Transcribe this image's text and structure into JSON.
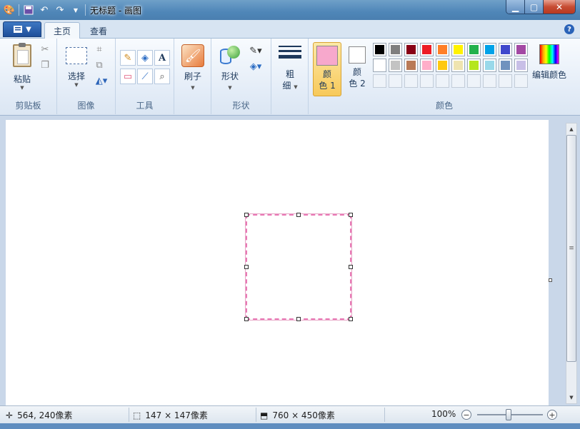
{
  "window": {
    "title": "无标题 - 画图"
  },
  "tabs": [
    {
      "label": "主页",
      "active": true
    },
    {
      "label": "查看",
      "active": false
    }
  ],
  "ribbon": {
    "clipboard": {
      "paste_label": "粘贴",
      "group_label": "剪贴板"
    },
    "image": {
      "select_label": "选择",
      "group_label": "图像"
    },
    "tools": {
      "group_label": "工具"
    },
    "brushes": {
      "label": "刷子"
    },
    "shapes": {
      "label": "形状",
      "group_label": "形状"
    },
    "size": {
      "label_line1": "粗",
      "label_line2": "细"
    },
    "colors": {
      "color1_line1": "颜",
      "color1_line2": "色 1",
      "color2_line1": "颜",
      "color2_line2": "色 2",
      "color1_value": "#f7a8cc",
      "color2_value": "#ffffff",
      "edit_label": "编辑颜色",
      "group_label": "颜色",
      "palette": [
        "#000000",
        "#7f7f7f",
        "#880015",
        "#ed1c24",
        "#ff7f27",
        "#fff200",
        "#22b14c",
        "#00a2e8",
        "#3f48cc",
        "#a349a4",
        "#ffffff",
        "#c3c3c3",
        "#b97a57",
        "#ffaec9",
        "#ffc90e",
        "#efe4b0",
        "#b5e61d",
        "#99d9ea",
        "#7092be",
        "#c8bfe7"
      ]
    }
  },
  "statusbar": {
    "cursor_pos": "564, 240像素",
    "selection_size": "147 × 147像素",
    "image_size": "760 × 450像素",
    "zoom": "100%"
  }
}
